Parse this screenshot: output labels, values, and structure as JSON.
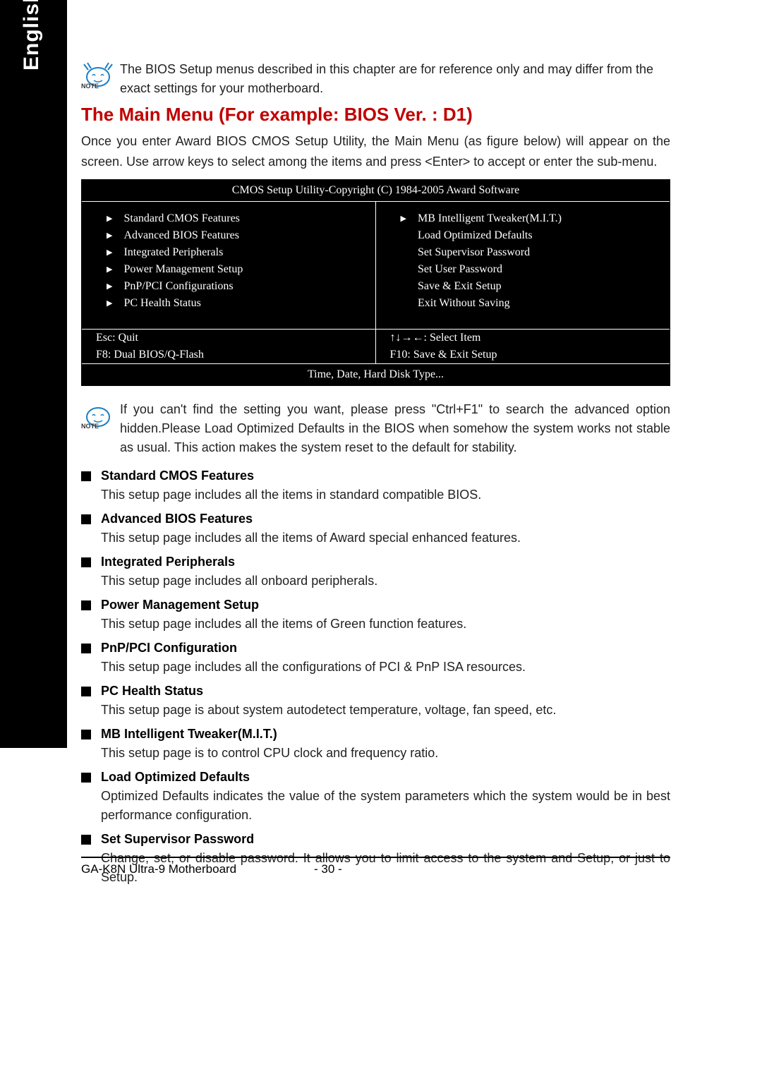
{
  "lang": "English",
  "note1": "The BIOS Setup menus described in this chapter are for reference only and may differ from the exact settings for your motherboard.",
  "note_label": "NOTE",
  "heading": "The Main Menu (For example: BIOS Ver. : D1)",
  "intro": "Once you enter Award BIOS CMOS Setup Utility, the Main Menu (as figure below) will appear on the screen.  Use arrow keys to select among the items and press <Enter> to accept or enter the sub-menu.",
  "bios": {
    "title": "CMOS Setup Utility-Copyright (C) 1984-2005 Award Software",
    "left": [
      "Standard CMOS Features",
      "Advanced BIOS Features",
      "Integrated Peripherals",
      "Power Management Setup",
      "PnP/PCI Configurations",
      "PC Health Status"
    ],
    "right_arrow": "MB Intelligent Tweaker(M.I.T.)",
    "right": [
      "Load Optimized Defaults",
      "Set Supervisor Password",
      "Set User Password",
      "Save & Exit Setup",
      "Exit Without Saving"
    ],
    "key_esc": "Esc: Quit",
    "key_arrows": "↑↓→←: Select Item",
    "key_f8": "F8: Dual BIOS/Q-Flash",
    "key_f10": "F10: Save & Exit Setup",
    "help": "Time, Date, Hard Disk Type..."
  },
  "note2": "If you can't find the setting you want, please press \"Ctrl+F1\" to search the advanced option hidden.Please Load Optimized Defaults in the BIOS when somehow the system works not stable as usual. This action makes the system reset to the default for stability.",
  "features": [
    {
      "title": "Standard CMOS Features",
      "desc": "This setup page includes all the items in standard compatible BIOS."
    },
    {
      "title": "Advanced BIOS Features",
      "desc": "This setup page includes all the items of Award special enhanced features."
    },
    {
      "title": "Integrated Peripherals",
      "desc": "This setup page includes all onboard peripherals."
    },
    {
      "title": "Power Management Setup",
      "desc": "This setup page includes all the items of Green function features."
    },
    {
      "title": "PnP/PCI Configuration",
      "desc": "This setup page includes all the configurations of PCI & PnP ISA resources."
    },
    {
      "title": "PC Health Status",
      "desc": "This setup page is about system autodetect temperature, voltage, fan speed, etc."
    },
    {
      "title": "MB Intelligent Tweaker(M.I.T.)",
      "desc": "This setup page is to control CPU clock and frequency ratio."
    },
    {
      "title": "Load Optimized Defaults",
      "desc": "Optimized Defaults indicates the value of the system parameters which the system would be in best performance configuration."
    },
    {
      "title": "Set Supervisor Password",
      "desc": "Change, set, or disable password. It allows you to limit access to the system and Setup, or just to Setup."
    }
  ],
  "footer": {
    "model": "GA-K8N Ultra-9 Motherboard",
    "page": "- 30 -"
  }
}
